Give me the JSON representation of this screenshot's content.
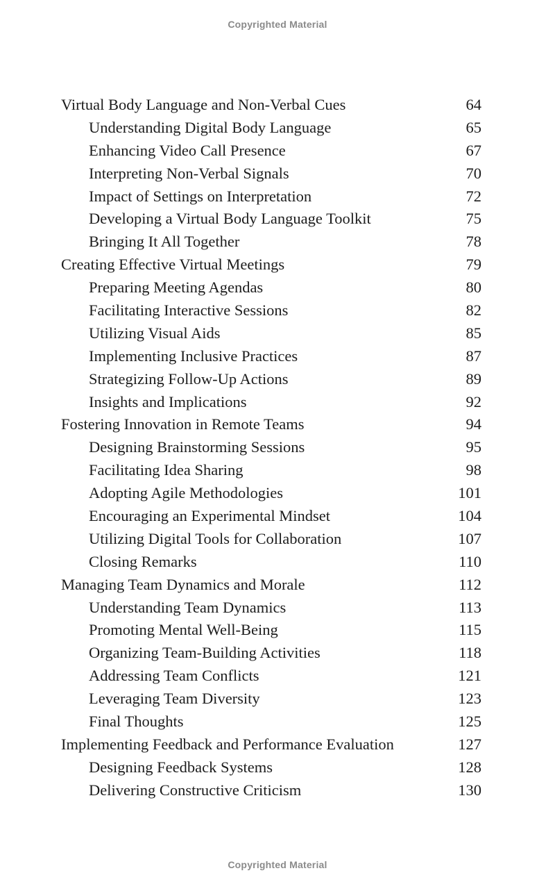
{
  "watermark": {
    "top": "Copyrighted Material",
    "bottom": "Copyrighted Material"
  },
  "toc": [
    {
      "level": 1,
      "title": "Virtual Body Language and Non-Verbal Cues",
      "page": "64"
    },
    {
      "level": 2,
      "title": "Understanding Digital Body Language",
      "page": "65"
    },
    {
      "level": 2,
      "title": "Enhancing Video Call Presence",
      "page": "67"
    },
    {
      "level": 2,
      "title": "Interpreting Non-Verbal Signals",
      "page": "70"
    },
    {
      "level": 2,
      "title": "Impact of Settings on Interpretation",
      "page": "72"
    },
    {
      "level": 2,
      "title": "Developing a Virtual Body Language Toolkit",
      "page": "75"
    },
    {
      "level": 2,
      "title": "Bringing It All Together",
      "page": "78"
    },
    {
      "level": 1,
      "title": "Creating Effective Virtual Meetings",
      "page": "79"
    },
    {
      "level": 2,
      "title": "Preparing Meeting Agendas",
      "page": "80"
    },
    {
      "level": 2,
      "title": "Facilitating Interactive Sessions",
      "page": "82"
    },
    {
      "level": 2,
      "title": "Utilizing Visual Aids",
      "page": "85"
    },
    {
      "level": 2,
      "title": "Implementing Inclusive Practices",
      "page": "87"
    },
    {
      "level": 2,
      "title": "Strategizing Follow-Up Actions",
      "page": "89"
    },
    {
      "level": 2,
      "title": "Insights and Implications",
      "page": "92"
    },
    {
      "level": 1,
      "title": "Fostering Innovation in Remote Teams",
      "page": "94"
    },
    {
      "level": 2,
      "title": "Designing Brainstorming Sessions",
      "page": "95"
    },
    {
      "level": 2,
      "title": "Facilitating Idea Sharing",
      "page": "98"
    },
    {
      "level": 2,
      "title": "Adopting Agile Methodologies",
      "page": "101"
    },
    {
      "level": 2,
      "title": "Encouraging an Experimental Mindset",
      "page": "104"
    },
    {
      "level": 2,
      "title": "Utilizing Digital Tools for Collaboration",
      "page": "107"
    },
    {
      "level": 2,
      "title": "Closing Remarks",
      "page": "110"
    },
    {
      "level": 1,
      "title": "Managing Team Dynamics and Morale",
      "page": "112"
    },
    {
      "level": 2,
      "title": "Understanding Team Dynamics",
      "page": "113"
    },
    {
      "level": 2,
      "title": "Promoting Mental Well-Being",
      "page": "115"
    },
    {
      "level": 2,
      "title": "Organizing Team-Building Activities",
      "page": "118"
    },
    {
      "level": 2,
      "title": "Addressing Team Conflicts",
      "page": "121"
    },
    {
      "level": 2,
      "title": "Leveraging Team Diversity",
      "page": "123"
    },
    {
      "level": 2,
      "title": "Final Thoughts",
      "page": "125"
    },
    {
      "level": 1,
      "title": "Implementing Feedback and Performance Evaluation",
      "page": "127"
    },
    {
      "level": 2,
      "title": "Designing Feedback Systems",
      "page": "128"
    },
    {
      "level": 2,
      "title": "Delivering Constructive Criticism",
      "page": "130"
    }
  ]
}
